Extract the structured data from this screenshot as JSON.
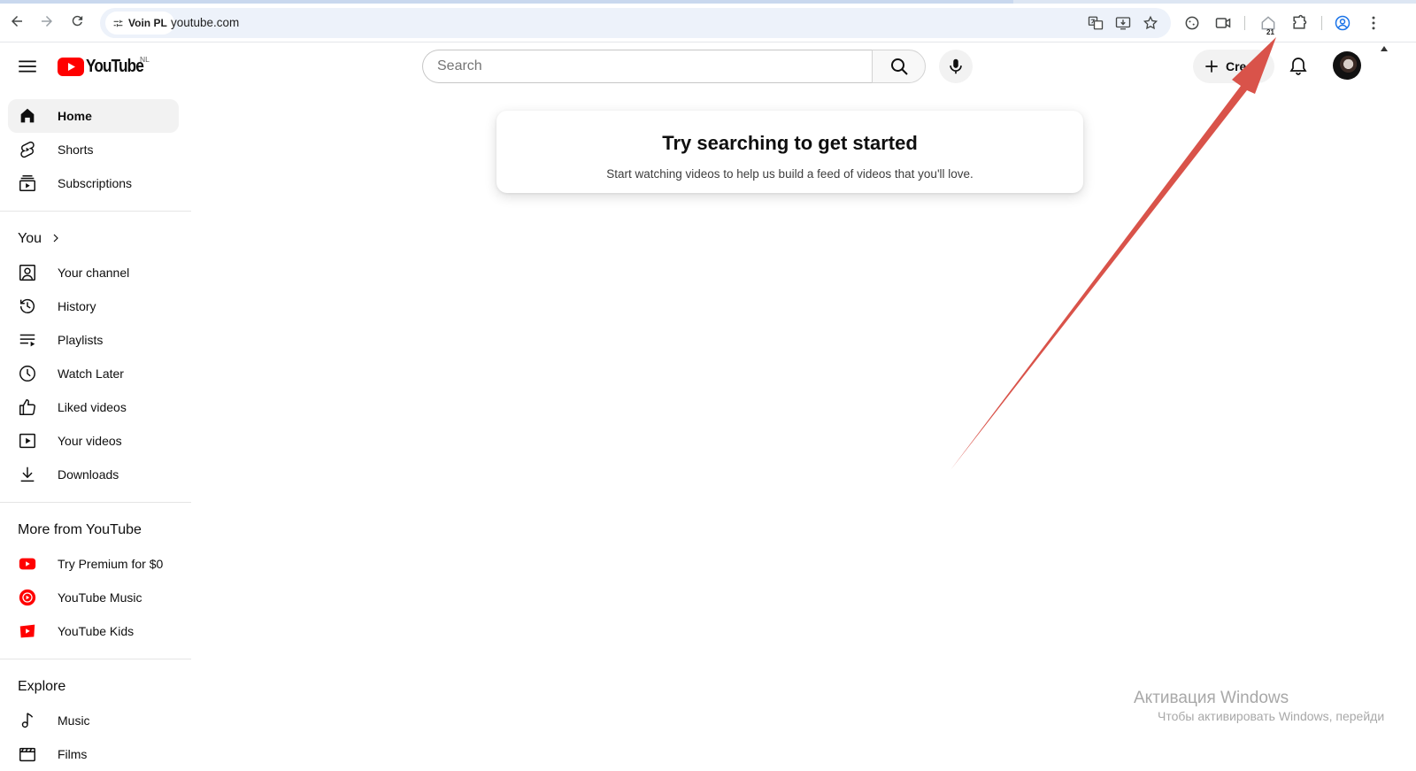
{
  "browser": {
    "site_chip": "Voin PL",
    "url": "youtube.com",
    "extension_badge": "21"
  },
  "masthead": {
    "logo_text": "YouTube",
    "country_code": "NL",
    "search_placeholder": "Search",
    "create_label": "Create"
  },
  "sidebar": {
    "main": [
      {
        "label": "Home",
        "icon": "home-icon",
        "active": true
      },
      {
        "label": "Shorts",
        "icon": "shorts-icon"
      },
      {
        "label": "Subscriptions",
        "icon": "subscriptions-icon"
      }
    ],
    "you_heading": "You",
    "you": [
      {
        "label": "Your channel",
        "icon": "channel-icon"
      },
      {
        "label": "History",
        "icon": "history-icon"
      },
      {
        "label": "Playlists",
        "icon": "playlists-icon"
      },
      {
        "label": "Watch Later",
        "icon": "clock-icon"
      },
      {
        "label": "Liked videos",
        "icon": "thumbs-up-icon"
      },
      {
        "label": "Your videos",
        "icon": "play-square-icon"
      },
      {
        "label": "Downloads",
        "icon": "download-icon"
      }
    ],
    "more_heading": "More from YouTube",
    "more": [
      {
        "label": "Try Premium for $0",
        "icon": "youtube-premium-icon"
      },
      {
        "label": "YouTube Music",
        "icon": "youtube-music-icon"
      },
      {
        "label": "YouTube Kids",
        "icon": "youtube-kids-icon"
      }
    ],
    "explore_heading": "Explore",
    "explore": [
      {
        "label": "Music",
        "icon": "music-note-icon"
      },
      {
        "label": "Films",
        "icon": "film-icon"
      }
    ]
  },
  "main": {
    "card_title": "Try searching to get started",
    "card_subtitle": "Start watching videos to help us build a feed of videos that you'll love."
  },
  "watermark": {
    "line1": "Активация Windows",
    "line2": "Чтобы активировать Windows, перейди"
  },
  "colors": {
    "youtube_red": "#ff0000",
    "annotation_arrow": "#d9534a",
    "omnibox_bg": "#edf2fa"
  }
}
